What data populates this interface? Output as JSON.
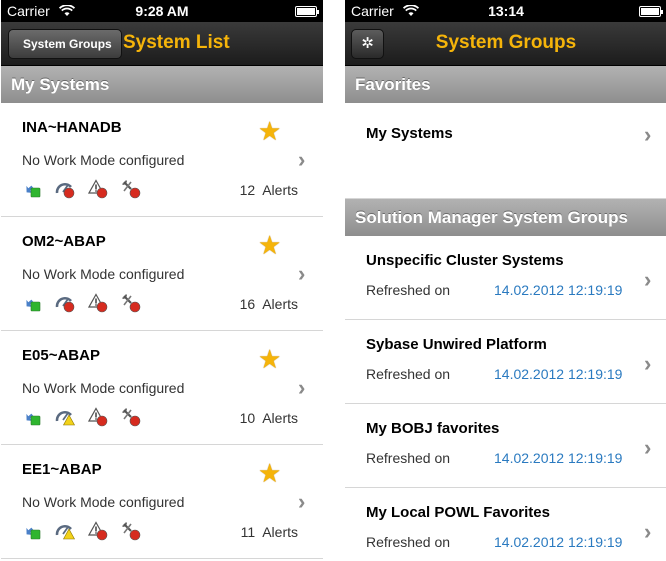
{
  "left": {
    "status": {
      "carrier": "Carrier",
      "time": "9:28 AM"
    },
    "nav": {
      "back_label": "System Groups",
      "title": "System List"
    },
    "section": "My Systems",
    "systems": [
      {
        "name": "INA~HANADB",
        "work_mode": "No Work Mode configured",
        "alerts_count": "12",
        "alerts_label": "Alerts",
        "status_icons": [
          "availability-up-icon",
          "performance-red-icon",
          "exceptions-red-icon",
          "configuration-red-icon"
        ]
      },
      {
        "name": "OM2~ABAP",
        "work_mode": "No Work Mode configured",
        "alerts_count": "16",
        "alerts_label": "Alerts",
        "status_icons": [
          "availability-up-icon",
          "performance-red-icon",
          "exceptions-red-icon",
          "configuration-red-icon"
        ]
      },
      {
        "name": "E05~ABAP",
        "work_mode": "No Work Mode configured",
        "alerts_count": "10",
        "alerts_label": "Alerts",
        "status_icons": [
          "availability-up-icon",
          "performance-yellow-icon",
          "exceptions-red-icon",
          "configuration-red-icon"
        ]
      },
      {
        "name": "EE1~ABAP",
        "work_mode": "No Work Mode configured",
        "alerts_count": "11",
        "alerts_label": "Alerts",
        "status_icons": [
          "availability-up-icon",
          "performance-yellow-icon",
          "exceptions-red-icon",
          "configuration-red-icon"
        ]
      }
    ]
  },
  "right": {
    "status": {
      "carrier": "Carrier",
      "time": "13:14"
    },
    "nav": {
      "title": "System Groups"
    },
    "favorites_header": "Favorites",
    "favorites": [
      {
        "label": "My Systems"
      }
    ],
    "groups_header": "Solution Manager System Groups",
    "groups": [
      {
        "name": "Unspecific Cluster Systems",
        "refreshed_label": "Refreshed on",
        "refreshed_date": "14.02.2012 12:19:19"
      },
      {
        "name": "Sybase Unwired Platform",
        "refreshed_label": "Refreshed on",
        "refreshed_date": "14.02.2012 12:19:19"
      },
      {
        "name": "My BOBJ favorites",
        "refreshed_label": "Refreshed on",
        "refreshed_date": "14.02.2012 12:19:19"
      },
      {
        "name": "My Local POWL Favorites",
        "refreshed_label": "Refreshed on",
        "refreshed_date": "14.02.2012 12:19:19"
      }
    ]
  },
  "colors": {
    "accent": "#f5b40a",
    "link": "#2a7ac0",
    "ok": "#2fb52f",
    "warning": "#f2d21a",
    "error": "#d62b1f"
  }
}
